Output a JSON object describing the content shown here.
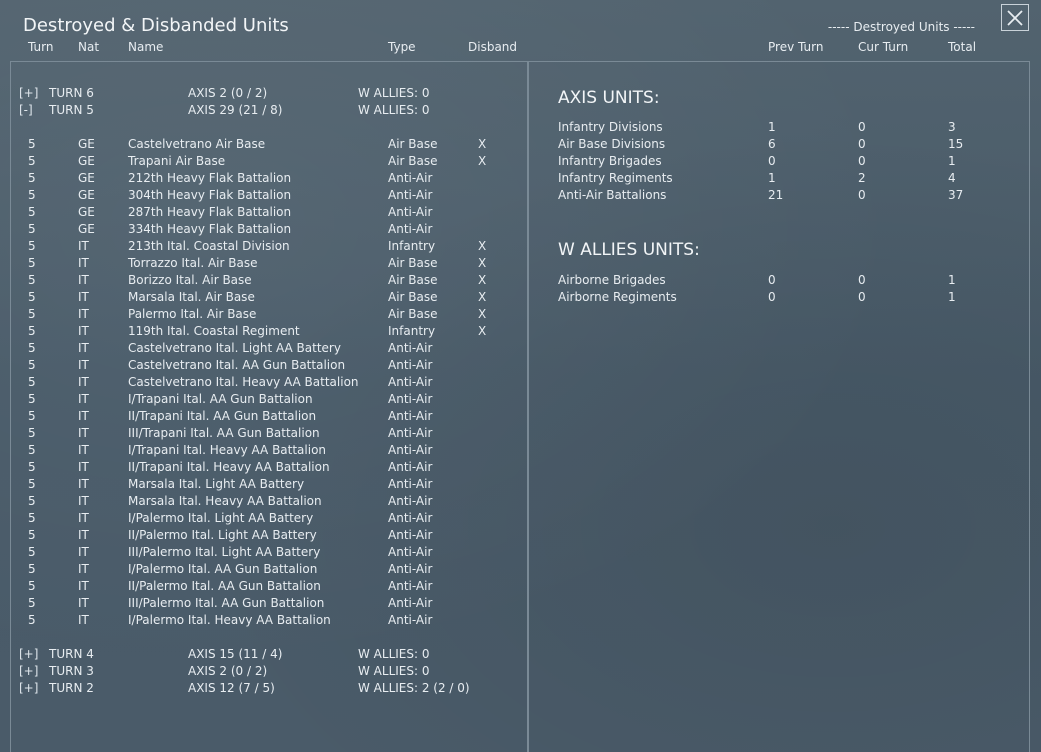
{
  "window": {
    "title": "Destroyed & Disbanded Units",
    "destroyed_header": "----- Destroyed Units -----",
    "close_label": "×"
  },
  "columns": {
    "turn": "Turn",
    "nat": "Nat",
    "name": "Name",
    "type": "Type",
    "disband": "Disband",
    "prev_turn": "Prev Turn",
    "cur_turn": "Cur Turn",
    "total": "Total"
  },
  "turns_top": [
    {
      "toggle": "[+]",
      "label": "TURN 6",
      "axis": "AXIS 2  (0 / 2)",
      "allies": "W ALLIES: 0"
    },
    {
      "toggle": "[-]",
      "label": "TURN 5",
      "axis": "AXIS 29  (21 / 8)",
      "allies": "W ALLIES: 0"
    }
  ],
  "units": [
    {
      "turn": "5",
      "nat": "GE",
      "name": "Castelvetrano Air Base",
      "type": "Air Base",
      "disband": "X"
    },
    {
      "turn": "5",
      "nat": "GE",
      "name": "Trapani Air Base",
      "type": "Air Base",
      "disband": "X"
    },
    {
      "turn": "5",
      "nat": "GE",
      "name": "212th Heavy Flak Battalion",
      "type": "Anti-Air",
      "disband": ""
    },
    {
      "turn": "5",
      "nat": "GE",
      "name": "304th Heavy Flak Battalion",
      "type": "Anti-Air",
      "disband": ""
    },
    {
      "turn": "5",
      "nat": "GE",
      "name": "287th Heavy Flak Battalion",
      "type": "Anti-Air",
      "disband": ""
    },
    {
      "turn": "5",
      "nat": "GE",
      "name": "334th Heavy Flak Battalion",
      "type": "Anti-Air",
      "disband": ""
    },
    {
      "turn": "5",
      "nat": "IT",
      "name": "213th Ital. Coastal Division",
      "type": "Infantry",
      "disband": "X"
    },
    {
      "turn": "5",
      "nat": "IT",
      "name": "Torrazzo Ital. Air Base",
      "type": "Air Base",
      "disband": "X"
    },
    {
      "turn": "5",
      "nat": "IT",
      "name": "Borizzo Ital. Air Base",
      "type": "Air Base",
      "disband": "X"
    },
    {
      "turn": "5",
      "nat": "IT",
      "name": "Marsala Ital. Air Base",
      "type": "Air Base",
      "disband": "X"
    },
    {
      "turn": "5",
      "nat": "IT",
      "name": "Palermo Ital. Air Base",
      "type": "Air Base",
      "disband": "X"
    },
    {
      "turn": "5",
      "nat": "IT",
      "name": "119th Ital. Coastal Regiment",
      "type": "Infantry",
      "disband": "X"
    },
    {
      "turn": "5",
      "nat": "IT",
      "name": "Castelvetrano Ital. Light AA Battery",
      "type": "Anti-Air",
      "disband": ""
    },
    {
      "turn": "5",
      "nat": "IT",
      "name": "Castelvetrano Ital. AA Gun Battalion",
      "type": "Anti-Air",
      "disband": ""
    },
    {
      "turn": "5",
      "nat": "IT",
      "name": "Castelvetrano Ital. Heavy AA Battalion",
      "type": "Anti-Air",
      "disband": ""
    },
    {
      "turn": "5",
      "nat": "IT",
      "name": "I/Trapani Ital. AA Gun Battalion",
      "type": "Anti-Air",
      "disband": ""
    },
    {
      "turn": "5",
      "nat": "IT",
      "name": "II/Trapani Ital. AA Gun Battalion",
      "type": "Anti-Air",
      "disband": ""
    },
    {
      "turn": "5",
      "nat": "IT",
      "name": "III/Trapani Ital. AA Gun Battalion",
      "type": "Anti-Air",
      "disband": ""
    },
    {
      "turn": "5",
      "nat": "IT",
      "name": "I/Trapani Ital. Heavy AA Battalion",
      "type": "Anti-Air",
      "disband": ""
    },
    {
      "turn": "5",
      "nat": "IT",
      "name": "II/Trapani Ital. Heavy AA Battalion",
      "type": "Anti-Air",
      "disband": ""
    },
    {
      "turn": "5",
      "nat": "IT",
      "name": "Marsala Ital. Light AA Battery",
      "type": "Anti-Air",
      "disband": ""
    },
    {
      "turn": "5",
      "nat": "IT",
      "name": "Marsala Ital. Heavy AA Battalion",
      "type": "Anti-Air",
      "disband": ""
    },
    {
      "turn": "5",
      "nat": "IT",
      "name": "I/Palermo Ital. Light AA Battery",
      "type": "Anti-Air",
      "disband": ""
    },
    {
      "turn": "5",
      "nat": "IT",
      "name": "II/Palermo Ital. Light AA Battery",
      "type": "Anti-Air",
      "disband": ""
    },
    {
      "turn": "5",
      "nat": "IT",
      "name": "III/Palermo Ital. Light AA Battery",
      "type": "Anti-Air",
      "disband": ""
    },
    {
      "turn": "5",
      "nat": "IT",
      "name": "I/Palermo Ital. AA Gun Battalion",
      "type": "Anti-Air",
      "disband": ""
    },
    {
      "turn": "5",
      "nat": "IT",
      "name": "II/Palermo Ital. AA Gun Battalion",
      "type": "Anti-Air",
      "disband": ""
    },
    {
      "turn": "5",
      "nat": "IT",
      "name": "III/Palermo Ital. AA Gun Battalion",
      "type": "Anti-Air",
      "disband": ""
    },
    {
      "turn": "5",
      "nat": "IT",
      "name": "I/Palermo Ital. Heavy AA Battalion",
      "type": "Anti-Air",
      "disband": ""
    }
  ],
  "turns_bottom": [
    {
      "toggle": "[+]",
      "label": "TURN 4",
      "axis": "AXIS 15  (11 / 4)",
      "allies": "W ALLIES: 0"
    },
    {
      "toggle": "[+]",
      "label": "TURN 3",
      "axis": "AXIS 2  (0 / 2)",
      "allies": "W ALLIES: 0"
    },
    {
      "toggle": "[+]",
      "label": "TURN 2",
      "axis": "AXIS 12  (7 / 5)",
      "allies": "W ALLIES: 2  (2 / 0)"
    }
  ],
  "axis_summary": {
    "title": "AXIS UNITS:",
    "rows": [
      {
        "name": "Infantry Divisions",
        "prev": "1",
        "cur": "0",
        "total": "3"
      },
      {
        "name": "Air Base Divisions",
        "prev": "6",
        "cur": "0",
        "total": "15"
      },
      {
        "name": "Infantry Brigades",
        "prev": "0",
        "cur": "0",
        "total": "1"
      },
      {
        "name": "Infantry Regiments",
        "prev": "1",
        "cur": "2",
        "total": "4"
      },
      {
        "name": "Anti-Air Battalions",
        "prev": "21",
        "cur": "0",
        "total": "37"
      }
    ]
  },
  "allies_summary": {
    "title": "W ALLIES UNITS:",
    "rows": [
      {
        "name": "Airborne Brigades",
        "prev": "0",
        "cur": "0",
        "total": "1"
      },
      {
        "name": "Airborne Regiments",
        "prev": "0",
        "cur": "0",
        "total": "1"
      }
    ]
  }
}
